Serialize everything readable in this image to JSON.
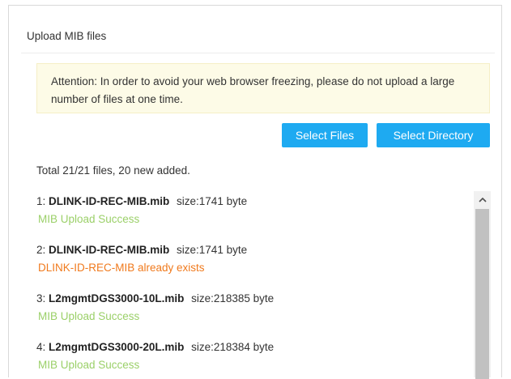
{
  "dialog": {
    "title": "Upload MIB files",
    "notice": "Attention: In order to avoid your web browser freezing, please do not upload a large number of files at one time.",
    "buttons": {
      "select_files": "Select Files",
      "select_directory": "Select Directory"
    },
    "summary": "Total 21/21 files, 20 new added.",
    "files": [
      {
        "index": "1:",
        "name": "DLINK-ID-REC-MIB.mib",
        "size": "size:1741 byte",
        "status": "MIB Upload Success",
        "status_type": "success"
      },
      {
        "index": "2:",
        "name": "DLINK-ID-REC-MIB.mib",
        "size": "size:1741 byte",
        "status": "DLINK-ID-REC-MIB already exists",
        "status_type": "error"
      },
      {
        "index": "3:",
        "name": "L2mgmtDGS3000-10L.mib",
        "size": "size:218385 byte",
        "status": "MIB Upload Success",
        "status_type": "success"
      },
      {
        "index": "4:",
        "name": "L2mgmtDGS3000-20L.mib",
        "size": "size:218384 byte",
        "status": "MIB Upload Success",
        "status_type": "success"
      }
    ]
  },
  "colors": {
    "button": "#1eaaf1",
    "success": "#9bd069",
    "error": "#f07a1d",
    "notice_bg": "#fdfbe7"
  },
  "icons": {
    "scroll_up": "chevron-up-icon"
  }
}
